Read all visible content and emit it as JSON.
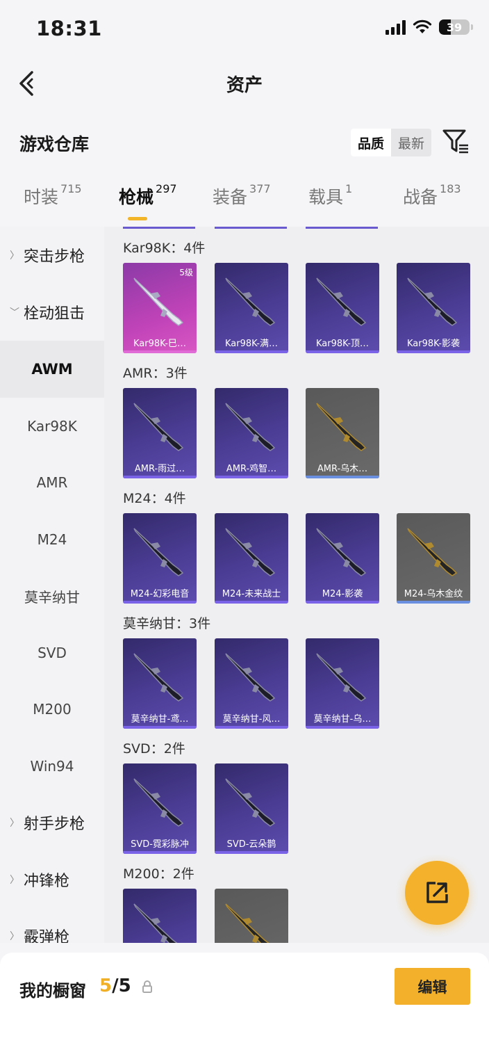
{
  "status_bar": {
    "time": "18:31",
    "battery": "39"
  },
  "nav": {
    "title": "资产"
  },
  "repo": {
    "title": "游戏仓库",
    "sort_quality": "品质",
    "sort_newest": "最新"
  },
  "tabs": [
    {
      "label": "时装",
      "count": "715"
    },
    {
      "label": "枪械",
      "count": "297"
    },
    {
      "label": "装备",
      "count": "377"
    },
    {
      "label": "载具",
      "count": "1"
    },
    {
      "label": "战备",
      "count": "183"
    }
  ],
  "sidebar": {
    "cat_assault": "突击步枪",
    "cat_bolt": "栓动狙击",
    "items": [
      "AWM",
      "Kar98K",
      "AMR",
      "M24",
      "莫辛纳甘",
      "SVD",
      "M200",
      "Win94"
    ],
    "cat_marksman": "射手步枪",
    "cat_smg": "冲锋枪",
    "cat_shotgun": "霰弹枪"
  },
  "groups": [
    {
      "title": "Kar98K：4件",
      "items": [
        {
          "caption": "Kar98K-巳…",
          "style": "pink",
          "level": "5级"
        },
        {
          "caption": "Kar98K-满…",
          "style": "purple"
        },
        {
          "caption": "Kar98K-顶…",
          "style": "purple"
        },
        {
          "caption": "Kar98K-影袭",
          "style": "purple"
        }
      ]
    },
    {
      "title": "AMR：3件",
      "items": [
        {
          "caption": "AMR-雨过…",
          "style": "purple"
        },
        {
          "caption": "AMR-鸡智…",
          "style": "purple"
        },
        {
          "caption": "AMR-乌木…",
          "style": "gray"
        }
      ]
    },
    {
      "title": "M24：4件",
      "items": [
        {
          "caption": "M24-幻彩电音",
          "style": "purple"
        },
        {
          "caption": "M24-未来战士",
          "style": "purple"
        },
        {
          "caption": "M24-影袭",
          "style": "purple"
        },
        {
          "caption": "M24-乌木金纹",
          "style": "gray"
        }
      ]
    },
    {
      "title": "莫辛纳甘：3件",
      "items": [
        {
          "caption": "莫辛纳甘-鸢…",
          "style": "purple"
        },
        {
          "caption": "莫辛纳甘-风…",
          "style": "purple"
        },
        {
          "caption": "莫辛纳甘-乌…",
          "style": "purple"
        }
      ]
    },
    {
      "title": "SVD：2件",
      "items": [
        {
          "caption": "SVD-霓彩脉冲",
          "style": "purple"
        },
        {
          "caption": "SVD-云朵鹊",
          "style": "purple"
        }
      ]
    },
    {
      "title": "M200：2件",
      "items": [
        {
          "caption": "",
          "style": "purple"
        },
        {
          "caption": "",
          "style": "gray"
        }
      ]
    }
  ],
  "showcase": {
    "label": "我的橱窗",
    "current": "5",
    "total": "/5",
    "edit_label": "编辑"
  },
  "colors": {
    "accent": "#f3b12c",
    "card_purple": "#4b3d95",
    "card_pink": "#c043b8",
    "card_gray": "#616161"
  }
}
